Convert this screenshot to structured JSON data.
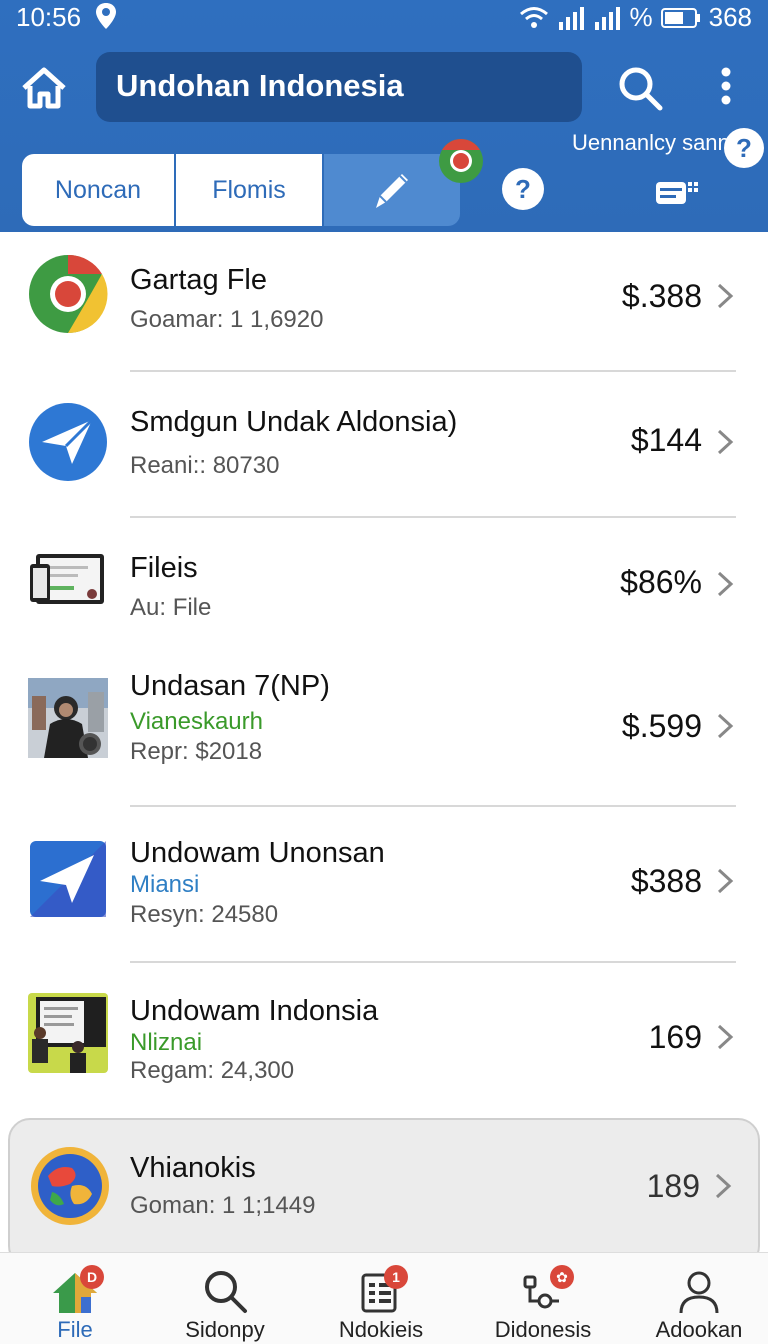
{
  "status_bar": {
    "time": "10:56",
    "battery_text": "368",
    "percent_symbol": "%"
  },
  "header": {
    "search_text": "Undohan Indonesia",
    "help_label": "Uennanlcy sann",
    "help_glyph": "?",
    "tabs": [
      {
        "label": "Noncan"
      },
      {
        "label": "Flomis"
      },
      {
        "label": "",
        "icon": "pen-icon"
      }
    ]
  },
  "list": {
    "items": [
      {
        "title": "Gartag Fle",
        "meta": "Goamar: 1 1,6920",
        "price": "$.388",
        "icon": "chrome-logo"
      },
      {
        "title": "Smdgun Undak Aldonsia)",
        "meta": "Reani:: 80730",
        "price": "$144",
        "icon": "send-logo"
      },
      {
        "title": "Fileis",
        "meta": "Au: File",
        "price": "$86%",
        "icon": "device-screens"
      },
      {
        "title": "Undasan 7(NP)",
        "subtitle": "Vianeskaurh",
        "meta": "Repr: $2018",
        "price": "$.599",
        "icon": "person-photo"
      },
      {
        "title": "Undowam Unonsan",
        "subtitle": "Miansi",
        "meta": "Resyn: 24580",
        "price": "$388",
        "icon": "send-logo-square"
      },
      {
        "title": "Undowam Indonsia",
        "subtitle": "Nliznai",
        "meta": "Regam: 24,300",
        "price": "169",
        "icon": "presentation-photo"
      },
      {
        "title": "Vhianokis",
        "meta": "Goman: 1 1;1449",
        "price": "189",
        "icon": "globe-logo"
      }
    ]
  },
  "bottom_nav": {
    "items": [
      {
        "label": "File",
        "badge": "D",
        "active": true
      },
      {
        "label": "Sidonpy"
      },
      {
        "label": "Ndokieis",
        "badge": "1"
      },
      {
        "label": "Didonesis",
        "badge": "✿"
      },
      {
        "label": "Adookan"
      }
    ]
  },
  "colors": {
    "header_bg": "#2e6bb8",
    "search_bg": "#1f4f8f",
    "accent_green": "#3a9a2a",
    "accent_blue": "#2f7fc4"
  }
}
